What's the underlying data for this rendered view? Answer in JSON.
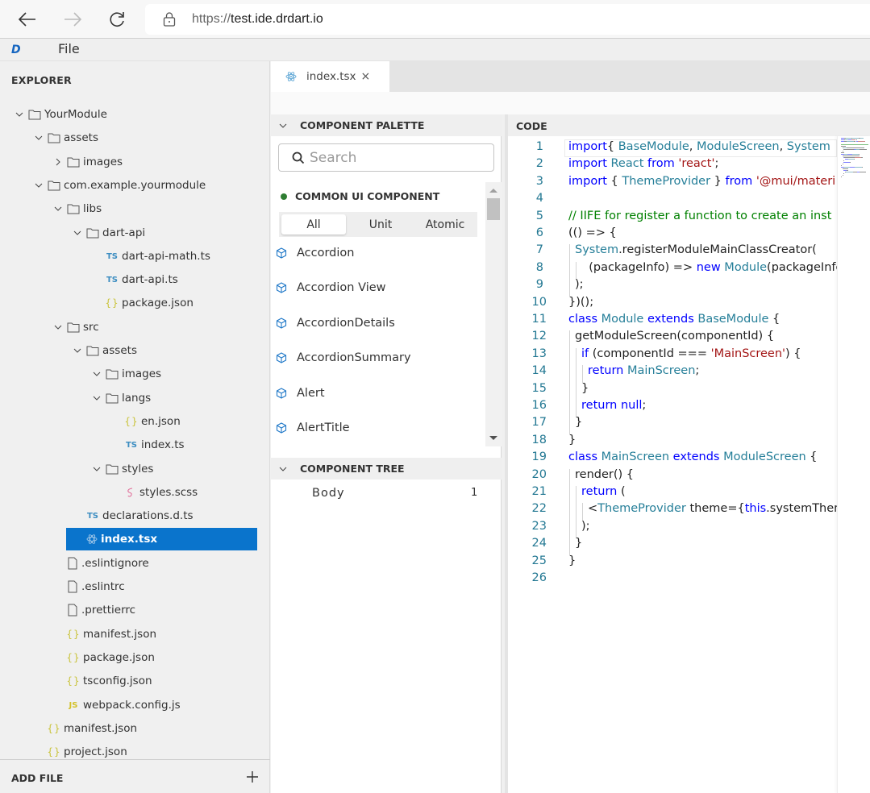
{
  "browser": {
    "url_protocol": "https://",
    "url_host": "test.ide.drdart.io"
  },
  "app": {
    "logo": "D",
    "menu": [
      "File"
    ]
  },
  "explorer": {
    "title": "EXPLORER",
    "items": [
      {
        "label": "YourModule",
        "type": "folder",
        "expanded": true,
        "depth": 0
      },
      {
        "label": "assets",
        "type": "folder",
        "expanded": true,
        "depth": 1
      },
      {
        "label": "images",
        "type": "folder",
        "expanded": false,
        "depth": 2
      },
      {
        "label": "com.example.yourmodule",
        "type": "folder",
        "expanded": true,
        "depth": 1
      },
      {
        "label": "libs",
        "type": "folder",
        "expanded": true,
        "depth": 2
      },
      {
        "label": "dart-api",
        "type": "folder",
        "expanded": true,
        "depth": 3
      },
      {
        "label": "dart-api-math.ts",
        "type": "ts",
        "depth": 4
      },
      {
        "label": "dart-api.ts",
        "type": "ts",
        "depth": 4
      },
      {
        "label": "package.json",
        "type": "json",
        "depth": 4
      },
      {
        "label": "src",
        "type": "folder",
        "expanded": true,
        "depth": 2
      },
      {
        "label": "assets",
        "type": "folder",
        "expanded": true,
        "depth": 3
      },
      {
        "label": "images",
        "type": "folder",
        "expanded": true,
        "depth": 4
      },
      {
        "label": "langs",
        "type": "folder",
        "expanded": true,
        "depth": 4
      },
      {
        "label": "en.json",
        "type": "json",
        "depth": 5
      },
      {
        "label": "index.ts",
        "type": "ts",
        "depth": 5
      },
      {
        "label": "styles",
        "type": "folder",
        "expanded": true,
        "depth": 4
      },
      {
        "label": "styles.scss",
        "type": "scss",
        "depth": 5
      },
      {
        "label": "declarations.d.ts",
        "type": "ts",
        "depth": 3
      },
      {
        "label": "index.tsx",
        "type": "tsx",
        "depth": 3,
        "selected": true
      },
      {
        "label": ".eslintignore",
        "type": "file",
        "depth": 2
      },
      {
        "label": ".eslintrc",
        "type": "file",
        "depth": 2
      },
      {
        "label": ".prettierrc",
        "type": "file",
        "depth": 2
      },
      {
        "label": "manifest.json",
        "type": "json",
        "depth": 2
      },
      {
        "label": "package.json",
        "type": "json",
        "depth": 2
      },
      {
        "label": "tsconfig.json",
        "type": "json",
        "depth": 2
      },
      {
        "label": "webpack.config.js",
        "type": "js",
        "depth": 2
      },
      {
        "label": "manifest.json",
        "type": "json",
        "depth": 1
      },
      {
        "label": "project.json",
        "type": "json",
        "depth": 1
      }
    ],
    "add_file_label": "ADD FILE"
  },
  "editor": {
    "tabs": [
      {
        "label": "index.tsx",
        "close": "×",
        "active": true
      }
    ]
  },
  "palette": {
    "title": "COMPONENT PALETTE",
    "search_placeholder": "Search",
    "category": "COMMON UI COMPONENT",
    "filters": [
      {
        "label": "All",
        "active": true
      },
      {
        "label": "Unit",
        "active": false
      },
      {
        "label": "Atomic",
        "active": false
      }
    ],
    "components": [
      "Accordion",
      "Accordion View",
      "AccordionDetails",
      "AccordionSummary",
      "Alert",
      "AlertTitle"
    ]
  },
  "component_tree": {
    "title": "COMPONENT TREE",
    "rows": [
      {
        "label": "Body",
        "count": "1"
      }
    ]
  },
  "code": {
    "title": "CODE",
    "lines": [
      [
        [
          "kw",
          "import"
        ],
        [
          "",
          "{ "
        ],
        [
          "ty",
          "BaseModule"
        ],
        [
          "",
          ", "
        ],
        [
          "ty",
          "ModuleScreen"
        ],
        [
          "",
          ", "
        ],
        [
          "ty",
          "System"
        ]
      ],
      [
        [
          "kw",
          "import"
        ],
        [
          "",
          ""
        ],
        [
          "ty",
          " React"
        ],
        [
          "kw",
          " from"
        ],
        [
          "str",
          " 'react'"
        ],
        [
          "",
          ";"
        ]
      ],
      [
        [
          "kw",
          "import"
        ],
        [
          "",
          ""
        ],
        [
          "",
          " { "
        ],
        [
          "ty",
          "ThemeProvider"
        ],
        [
          "",
          " } "
        ],
        [
          "kw",
          "from"
        ],
        [
          "str",
          " '@mui/materi"
        ]
      ],
      [],
      [
        [
          "cm",
          "// IIFE for register a function to create an inst"
        ]
      ],
      [
        [
          "",
          "(() => {"
        ]
      ],
      [
        [
          "",
          ""
        ],
        [
          "ty",
          "System"
        ],
        [
          "",
          ".registerModuleMainClassCreator("
        ]
      ],
      [
        [
          "",
          "  (packageInfo) => "
        ],
        [
          "kw",
          "new"
        ],
        [
          "ty",
          " Module"
        ],
        [
          "",
          "(packageInfo)"
        ]
      ],
      [
        [
          "",
          ");"
        ]
      ],
      [
        [
          "",
          "})();"
        ]
      ],
      [
        [
          "kw",
          "class"
        ],
        [
          "ty",
          " Module"
        ],
        [
          "kw",
          " extends"
        ],
        [
          "ty",
          " BaseModule"
        ],
        [
          "",
          " {"
        ]
      ],
      [
        [
          "",
          "getModuleScreen(componentId) {"
        ]
      ],
      [
        [
          "kw",
          "if"
        ],
        [
          "",
          " (componentId === "
        ],
        [
          "str",
          "'MainScreen'"
        ],
        [
          "",
          ") {"
        ]
      ],
      [
        [
          "kw",
          "return"
        ],
        [
          "ty",
          " MainScreen"
        ],
        [
          "",
          ";"
        ]
      ],
      [
        [
          "",
          "}"
        ]
      ],
      [
        [
          "kw",
          "return"
        ],
        [
          "kw",
          " null"
        ],
        [
          "",
          ";"
        ]
      ],
      [
        [
          "",
          "}"
        ]
      ],
      [
        [
          "",
          "}"
        ]
      ],
      [
        [
          "kw",
          "class"
        ],
        [
          "ty",
          " MainScreen"
        ],
        [
          "kw",
          " extends"
        ],
        [
          "ty",
          " ModuleScreen"
        ],
        [
          "",
          " {"
        ]
      ],
      [
        [
          "",
          "render() {"
        ]
      ],
      [
        [
          "kw",
          "return"
        ],
        [
          "",
          " ("
        ]
      ],
      [
        [
          "",
          "<"
        ],
        [
          "ty",
          "ThemeProvider"
        ],
        [
          "",
          " theme={"
        ],
        [
          "kw",
          "this"
        ],
        [
          "",
          ".systemThem"
        ]
      ],
      [
        [
          "",
          ");"
        ]
      ],
      [
        [
          "",
          "}"
        ]
      ],
      [
        [
          "",
          "}"
        ]
      ],
      []
    ],
    "indents": [
      0,
      0,
      0,
      0,
      0,
      0,
      1,
      2,
      1,
      0,
      0,
      1,
      2,
      3,
      2,
      2,
      1,
      0,
      0,
      1,
      2,
      3,
      2,
      1,
      0,
      0
    ]
  }
}
